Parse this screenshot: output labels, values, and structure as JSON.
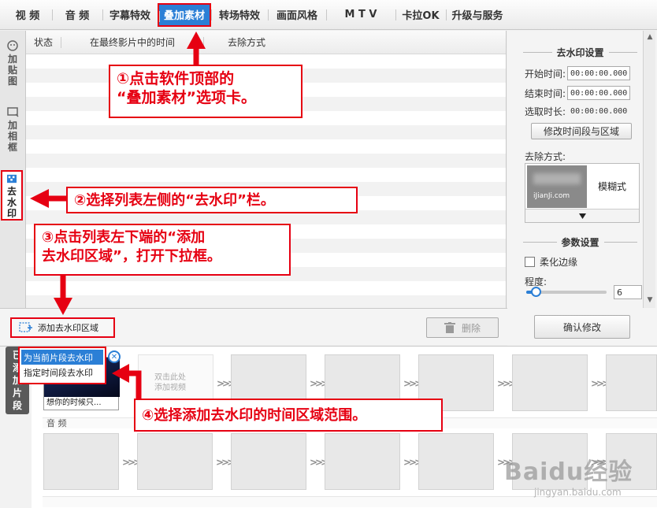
{
  "top_tabs": [
    {
      "label": "视 频"
    },
    {
      "label": "音 频"
    },
    {
      "label": "字幕特效"
    },
    {
      "label": "叠加素材"
    },
    {
      "label": "转场特效"
    },
    {
      "label": "画面风格"
    },
    {
      "label": "M T V"
    },
    {
      "label": "卡拉OK"
    },
    {
      "label": "升级与服务"
    }
  ],
  "left_tabs": [
    {
      "label": "加\n贴\n图",
      "icon": "sticker-icon"
    },
    {
      "label": "加\n相\n框",
      "icon": "frame-icon"
    },
    {
      "label": "去\n水\n印",
      "icon": "watermark-icon"
    }
  ],
  "list": {
    "columns": [
      "状态",
      "在最终影片中的时间",
      "去除方式"
    ]
  },
  "right_panel": {
    "watermark_settings_title": "去水印设置",
    "start_time_label": "开始时间:",
    "start_time_value": "00:00:00.000",
    "end_time_label": "结束时间:",
    "end_time_value": "00:00:00.000",
    "duration_label": "选取时长:",
    "duration_value": "00:00:00.000",
    "modify_range_button": "修改时间段与区域",
    "removal_method_label": "去除方式:",
    "removal_preview_text": "iJianJi.com",
    "removal_method_value": "模糊式",
    "param_settings_title": "参数设置",
    "soft_edge_label": "柔化边缘",
    "degree_label": "程度:",
    "degree_value": "6",
    "degree_fraction": 0.12,
    "confirm_button": "确认修改"
  },
  "list_toolbar": {
    "add_region_button": "添加去水印区域",
    "delete_button": "删除"
  },
  "popup": {
    "items": [
      "为当前片段去水印",
      "指定时间段去水印"
    ]
  },
  "timeline": {
    "video_tab": "已\n添\n加\n片\n段",
    "clip_caption": "想你的时候只...",
    "empty_slot_hint": "双击此处\n添加视频",
    "audio_label": "音 频"
  },
  "annotations": {
    "step1": "①点击软件顶部的\n“叠加素材”选项卡。",
    "step2": "②选择列表左侧的“去水印”栏。",
    "step3": "③点击列表左下端的“添加\n去水印区域”，打开下拉框。",
    "step4": "④选择添加去水印的时间区域范围。"
  },
  "watermark": {
    "brand": "Baidu经验",
    "url": "jingyan.baidu.com"
  },
  "colors": {
    "accent_blue": "#2b7fd6",
    "annotation_red": "#e60012"
  }
}
